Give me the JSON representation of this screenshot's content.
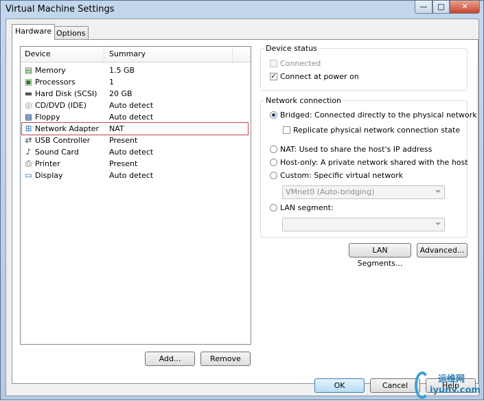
{
  "window": {
    "title": "Virtual Machine Settings",
    "close_glyph": "✕",
    "max_glyph": "□",
    "min_glyph": "—"
  },
  "tabs": [
    {
      "label": "Hardware"
    },
    {
      "label": "Options"
    }
  ],
  "device_list": {
    "columns": {
      "device": "Device",
      "summary": "Summary"
    },
    "rows": [
      {
        "name": "Memory",
        "summary": "1.5 GB",
        "icon": "memory-icon"
      },
      {
        "name": "Processors",
        "summary": "1",
        "icon": "processor-icon"
      },
      {
        "name": "Hard Disk (SCSI)",
        "summary": "20 GB",
        "icon": "hard-disk-icon"
      },
      {
        "name": "CD/DVD (IDE)",
        "summary": "Auto detect",
        "icon": "cd-dvd-icon"
      },
      {
        "name": "Floppy",
        "summary": "Auto detect",
        "icon": "floppy-icon"
      },
      {
        "name": "Network Adapter",
        "summary": "NAT",
        "icon": "network-adapter-icon",
        "selected": true
      },
      {
        "name": "USB Controller",
        "summary": "Present",
        "icon": "usb-icon"
      },
      {
        "name": "Sound Card",
        "summary": "Auto detect",
        "icon": "sound-card-icon"
      },
      {
        "name": "Printer",
        "summary": "Present",
        "icon": "printer-icon"
      },
      {
        "name": "Display",
        "summary": "Auto detect",
        "icon": "display-icon"
      }
    ]
  },
  "buttons": {
    "add": "Add...",
    "remove": "Remove",
    "lan_segments": "LAN Segments...",
    "advanced": "Advanced...",
    "ok": "OK",
    "cancel": "Cancel",
    "help": "Help"
  },
  "device_status": {
    "title": "Device status",
    "connected": "Connected",
    "connect_at_power_on": "Connect at power on"
  },
  "network_connection": {
    "title": "Network connection",
    "bridged": "Bridged: Connected directly to the physical network",
    "replicate": "Replicate physical network connection state",
    "nat": "NAT: Used to share the host's IP address",
    "host_only": "Host-only: A private network shared with the host",
    "custom": "Custom: Specific virtual network",
    "vmnet_value": "VMnet0 (Auto-bridging)",
    "lan_segment": "LAN segment:",
    "lan_segment_value": ""
  },
  "watermark": {
    "line1": "运维网",
    "line2": "iyunv.com"
  },
  "colors": {
    "selection_border": "#c0404a",
    "accent": "#3aa0d8"
  }
}
